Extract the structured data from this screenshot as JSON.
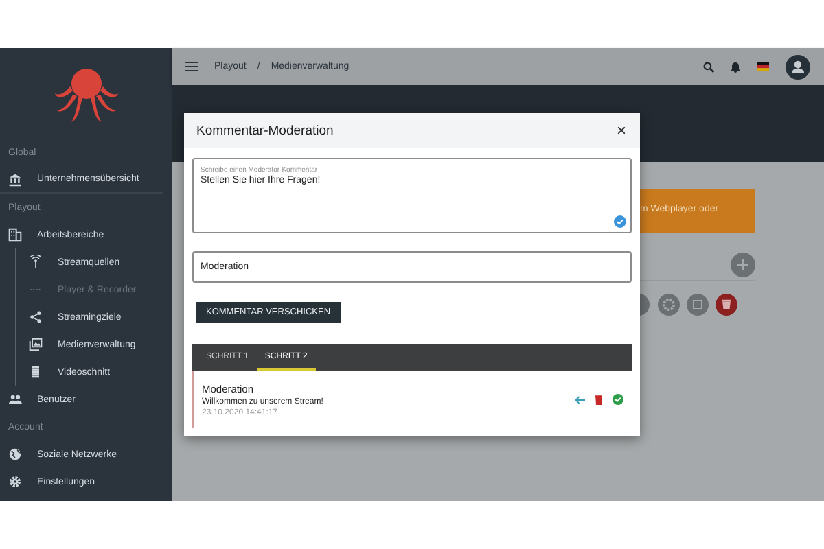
{
  "sidebar": {
    "sections": [
      {
        "heading": "Global",
        "items": [
          {
            "label": "Unternehmensübersicht",
            "kind": "bank",
            "disabled": false
          }
        ]
      },
      {
        "heading": "Playout",
        "items": [
          {
            "label": "Arbeitsbereiche",
            "kind": "building",
            "disabled": false,
            "children": [
              {
                "label": "Streamquellen",
                "kind": "antenna",
                "disabled": false
              },
              {
                "label": "Player & Recorder",
                "kind": "dots",
                "disabled": true
              },
              {
                "label": "Streamingziele",
                "kind": "share",
                "disabled": false
              },
              {
                "label": "Medienverwaltung",
                "kind": "photos",
                "disabled": false
              },
              {
                "label": "Videoschnitt",
                "kind": "film",
                "disabled": false
              }
            ]
          },
          {
            "label": "Benutzer",
            "kind": "people",
            "disabled": false
          }
        ]
      },
      {
        "heading": "Account",
        "items": [
          {
            "label": "Soziale Netzwerke",
            "kind": "globe",
            "disabled": false
          },
          {
            "label": "Einstellungen",
            "kind": "gear",
            "disabled": false
          }
        ]
      }
    ]
  },
  "topbar": {
    "breadcrumb": [
      "Playout",
      "Medienverwaltung"
    ],
    "separator": "/"
  },
  "background": {
    "banner": "m Webplayer oder"
  },
  "dialog": {
    "title": "Kommentar-Moderation",
    "close": "×",
    "comment_field": {
      "label": "Schreibe einen Moderator-Kommentar",
      "value": "Stellen Sie hier Ihre Fragen!"
    },
    "name_field": {
      "value": "Moderation"
    },
    "send_button": "KOMMENTAR VERSCHICKEN",
    "tabs": [
      {
        "label": "SCHRITT 1",
        "selected": false
      },
      {
        "label": "SCHRITT 2",
        "selected": true
      }
    ],
    "comments": [
      {
        "author": "Moderation",
        "text": "Willkommen zu unserem Stream!",
        "time": "23.10.2020 14:41:17"
      }
    ]
  }
}
